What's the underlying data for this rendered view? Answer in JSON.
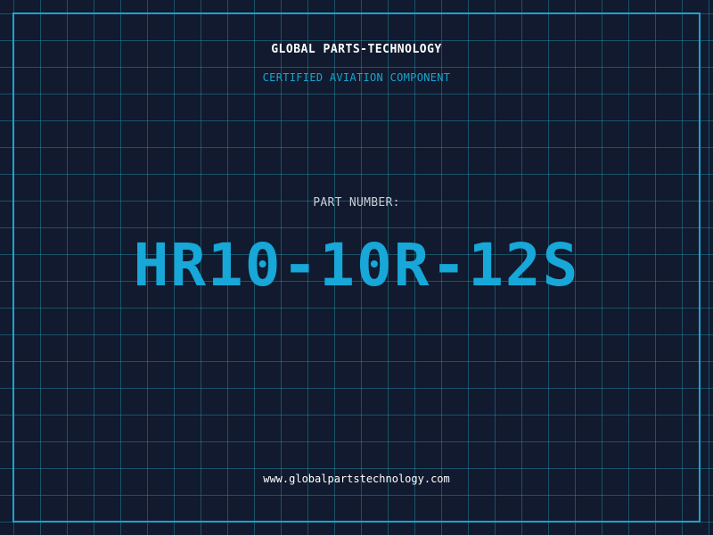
{
  "header": {
    "company": "GLOBAL PARTS-TECHNOLOGY",
    "subtitle": "CERTIFIED AVIATION COMPONENT"
  },
  "part": {
    "label": "PART NUMBER:",
    "number": "HR10-10R-12S"
  },
  "footer": {
    "website": "www.globalpartstechnology.com"
  },
  "colors": {
    "background": "#111a2e",
    "accent": "#1aa4d0",
    "grid": "#2696af",
    "text": "#ffffff"
  }
}
